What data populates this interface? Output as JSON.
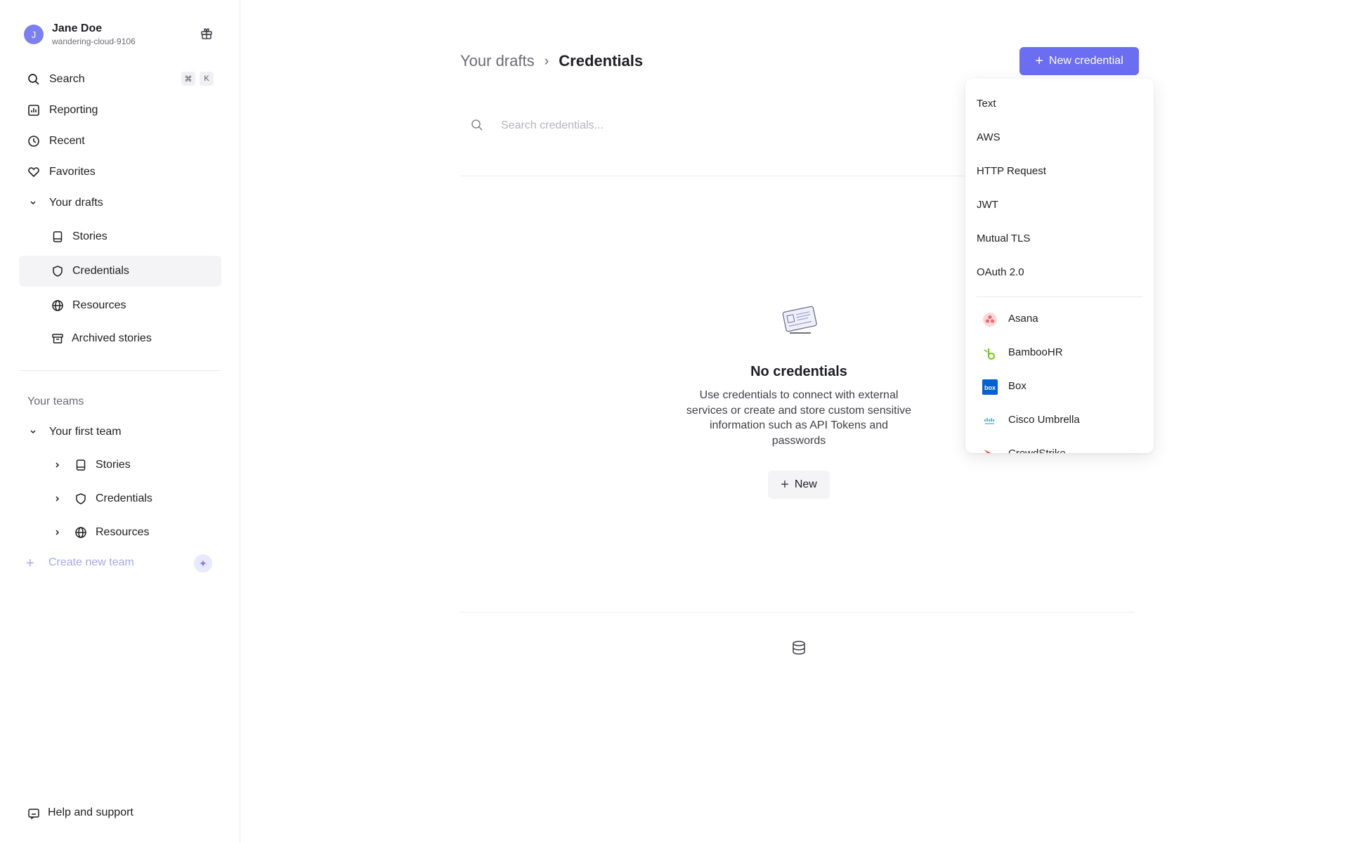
{
  "user": {
    "initial": "J",
    "name": "Jane Doe",
    "workspace": "wandering-cloud-9106"
  },
  "sidebar": {
    "search": {
      "label": "Search",
      "shortcut_mod": "⌘",
      "shortcut_key": "K"
    },
    "reporting": "Reporting",
    "recent": "Recent",
    "favorites": "Favorites",
    "drafts": {
      "label": "Your drafts",
      "items": [
        "Stories",
        "Credentials",
        "Resources",
        "Archived stories"
      ]
    },
    "teams_label": "Your teams",
    "team": {
      "label": "Your first team",
      "items": [
        "Stories",
        "Credentials",
        "Resources"
      ]
    },
    "create_team": "Create new team",
    "help": "Help and support"
  },
  "breadcrumb": {
    "parent": "Your drafts",
    "current": "Credentials"
  },
  "header": {
    "new_credential": "New credential"
  },
  "search": {
    "placeholder": "Search credentials..."
  },
  "empty": {
    "title": "No credentials",
    "description": "Use credentials to connect with external services or create and store custom sensitive information such as API Tokens and passwords",
    "new_button": "New"
  },
  "dropdown": {
    "basic_types": [
      "Text",
      "AWS",
      "HTTP Request",
      "JWT",
      "Mutual TLS",
      "OAuth 2.0"
    ],
    "integrations": [
      {
        "name": "Asana",
        "icon": "asana-logo",
        "color": "#f06a6a"
      },
      {
        "name": "BambooHR",
        "icon": "bamboohr-logo",
        "color": "#73c41d"
      },
      {
        "name": "Box",
        "icon": "box-logo",
        "color": "#0061d5"
      },
      {
        "name": "Cisco Umbrella",
        "icon": "cisco-logo",
        "color": "#049fd9"
      },
      {
        "name": "CrowdStrike",
        "icon": "crowdstrike-logo",
        "color": "#e8492f"
      }
    ]
  },
  "colors": {
    "accent": "#6b6ef0",
    "avatar": "#7c7ff0"
  }
}
